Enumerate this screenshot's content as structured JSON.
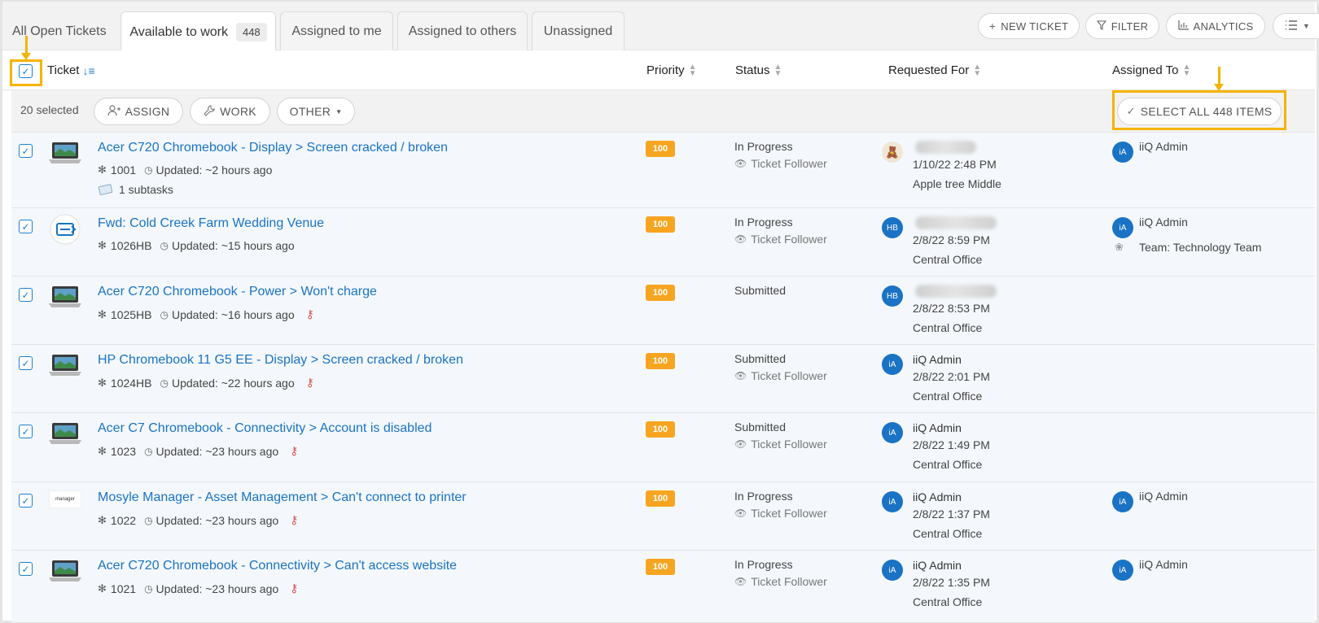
{
  "tabs": [
    {
      "label": "All Open Tickets"
    },
    {
      "label": "Available to work",
      "count": "448"
    },
    {
      "label": "Assigned to me"
    },
    {
      "label": "Assigned to others"
    },
    {
      "label": "Unassigned"
    }
  ],
  "toolbar": {
    "new_ticket": "NEW TICKET",
    "filter": "FILTER",
    "analytics": "ANALYTICS"
  },
  "columns": {
    "ticket": "Ticket",
    "priority": "Priority",
    "status": "Status",
    "requested_for": "Requested For",
    "assigned_to": "Assigned To"
  },
  "selection": {
    "selected_text": "20 selected",
    "assign": "ASSIGN",
    "work": "WORK",
    "other": "OTHER",
    "select_all": "SELECT ALL 448 ITEMS"
  },
  "colors": {
    "accent": "#1a73c4",
    "highlight": "#f5b301",
    "priority_badge": "#f7a521"
  },
  "rows": [
    {
      "title": "Acer C720 Chromebook - Display > Screen cracked / broken",
      "number": "1001",
      "updated": "Updated: ~2 hours ago",
      "subtasks": "1 subtasks",
      "priority": "100",
      "status": "In Progress",
      "follower": "Ticket Follower",
      "requester_name": "",
      "requester_initials": "",
      "request_date": "1/10/22 2:48 PM",
      "location": "Apple tree Middle",
      "assignee_initials": "iA",
      "assignee": "iiQ Admin",
      "team": "",
      "thumb": "laptop"
    },
    {
      "title": "Fwd: Cold Creek Farm Wedding Venue",
      "number": "1026HB",
      "updated": "Updated: ~15 hours ago",
      "priority": "100",
      "status": "In Progress",
      "follower": "Ticket Follower",
      "requester_initials": "HB",
      "request_date": "2/8/22 8:59 PM",
      "location": "Central Office",
      "assignee_initials": "iA",
      "assignee": "iiQ Admin",
      "team": "Team: Technology Team",
      "thumb": "ticket-icon"
    },
    {
      "title": "Acer C720 Chromebook - Power > Won't charge",
      "number": "1025HB",
      "updated": "Updated: ~16 hours ago",
      "priority": "100",
      "status": "Submitted",
      "requester_initials": "HB",
      "request_date": "2/8/22 8:53 PM",
      "location": "Central Office",
      "thumb": "laptop"
    },
    {
      "title": "HP Chromebook 11 G5 EE - Display > Screen cracked / broken",
      "number": "1024HB",
      "updated": "Updated: ~22 hours ago",
      "priority": "100",
      "status": "Submitted",
      "follower": "Ticket Follower",
      "requester_initials": "iA",
      "requester_name": "iiQ Admin",
      "request_date": "2/8/22 2:01 PM",
      "location": "Central Office",
      "thumb": "laptop"
    },
    {
      "title": "Acer C7 Chromebook - Connectivity > Account is disabled",
      "number": "1023",
      "updated": "Updated: ~23 hours ago",
      "priority": "100",
      "status": "Submitted",
      "follower": "Ticket Follower",
      "requester_initials": "iA",
      "requester_name": "iiQ Admin",
      "request_date": "2/8/22 1:49 PM",
      "location": "Central Office",
      "thumb": "laptop"
    },
    {
      "title": "Mosyle Manager - Asset Management > Can't connect to printer",
      "number": "1022",
      "updated": "Updated: ~23 hours ago",
      "priority": "100",
      "status": "In Progress",
      "follower": "Ticket Follower",
      "requester_initials": "iA",
      "requester_name": "iiQ Admin",
      "request_date": "2/8/22 1:37 PM",
      "location": "Central Office",
      "assignee_initials": "iA",
      "assignee": "iiQ Admin",
      "thumb": "manager-logo",
      "thumb_text": "manager"
    },
    {
      "title": "Acer C720 Chromebook - Connectivity > Can't access website",
      "number": "1021",
      "updated": "Updated: ~23 hours ago",
      "priority": "100",
      "status": "In Progress",
      "follower": "Ticket Follower",
      "requester_initials": "iA",
      "requester_name": "iiQ Admin",
      "request_date": "2/8/22 1:35 PM",
      "location": "Central Office",
      "assignee_initials": "iA",
      "assignee": "iiQ Admin",
      "thumb": "laptop"
    }
  ]
}
